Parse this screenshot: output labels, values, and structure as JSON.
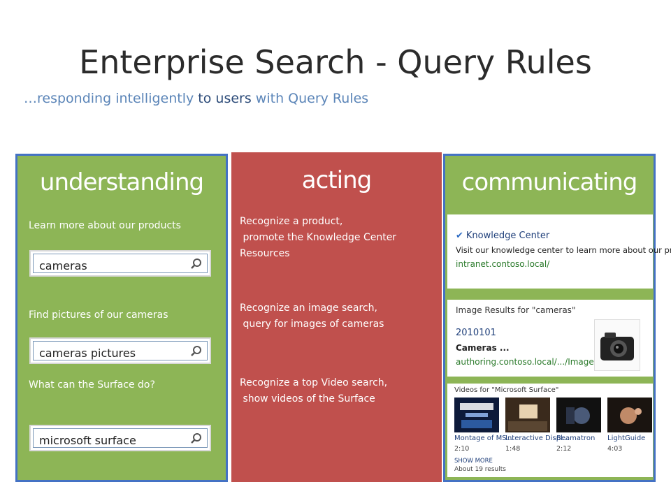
{
  "slide": {
    "title": "Enterprise Search - Query Rules",
    "subtitle_prefix": "…responding  intelligently ",
    "subtitle_to": "to",
    "subtitle_users": " users ",
    "subtitle_rest": "with Query Rules"
  },
  "understanding": {
    "heading": "understanding",
    "items": [
      {
        "note": "Learn more about our products",
        "query": "cameras"
      },
      {
        "note": "Find pictures of our cameras",
        "query": "cameras pictures"
      },
      {
        "note": "What can the Surface do?",
        "query": "microsoft surface"
      }
    ]
  },
  "acting": {
    "heading": "acting",
    "rules": [
      {
        "line1": "Recognize  a product,",
        "line2": " promote the Knowledge Center",
        "line3": "Resources"
      },
      {
        "line1": "Recognize  an image search,",
        "line2": " query for images of cameras"
      },
      {
        "line1": "Recognize  a top Video search,",
        "line2": " show videos of the Surface"
      }
    ]
  },
  "communicating": {
    "heading": "communicating",
    "knowledge": {
      "title": "Knowledge Center",
      "description": "Visit our knowledge center to learn more about our products.",
      "url": "intranet.contoso.local/"
    },
    "images": {
      "title": "Image Results for \"cameras\"",
      "id": "2010101",
      "name": "Cameras ...",
      "url": "authoring.contoso.local/.../Images"
    },
    "videos": {
      "title": "Videos for \"Microsoft Surface\"",
      "items": [
        {
          "caption": "Montage of MS...",
          "duration": "2:10"
        },
        {
          "caption": "Interactive Displ...",
          "duration": "1:48"
        },
        {
          "caption": "Beamatron",
          "duration": "2:12"
        },
        {
          "caption": "LightGuide",
          "duration": "4:03"
        }
      ],
      "show_more": "SHOW MORE",
      "count": "About 19 results"
    }
  },
  "colors": {
    "green": "#8db556",
    "red": "#c0504d",
    "border_blue": "#4472c4",
    "subtitle_blue": "#5b85b8"
  }
}
